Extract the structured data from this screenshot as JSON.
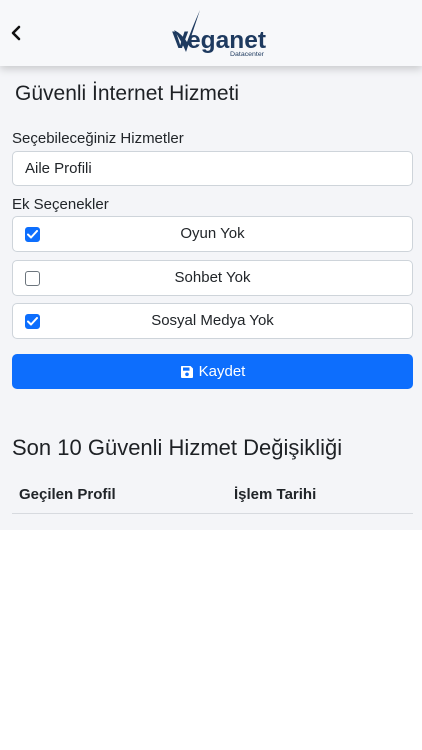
{
  "header": {
    "back_icon": "chevron-left-icon",
    "logo": {
      "brand": "Veganet",
      "tagline": "Datacenter",
      "color": "#1e3a5f"
    }
  },
  "page_title": "Güvenli İnternet Hizmeti",
  "services": {
    "label": "Seçebileceğiniz Hizmetler",
    "selected": "Aile Profili"
  },
  "extras": {
    "label": "Ek Seçenekler",
    "options": [
      {
        "label": "Oyun Yok",
        "checked": true
      },
      {
        "label": "Sohbet Yok",
        "checked": false
      },
      {
        "label": "Sosyal Medya Yok",
        "checked": true
      }
    ]
  },
  "save_button": {
    "label": "Kaydet",
    "icon": "floppy-disk-icon",
    "color": "#0d6efd"
  },
  "history": {
    "title": "Son 10 Güvenli Hizmet Değişikliği",
    "columns": [
      "Geçilen Profil",
      "İşlem Tarihi"
    ],
    "rows": []
  }
}
